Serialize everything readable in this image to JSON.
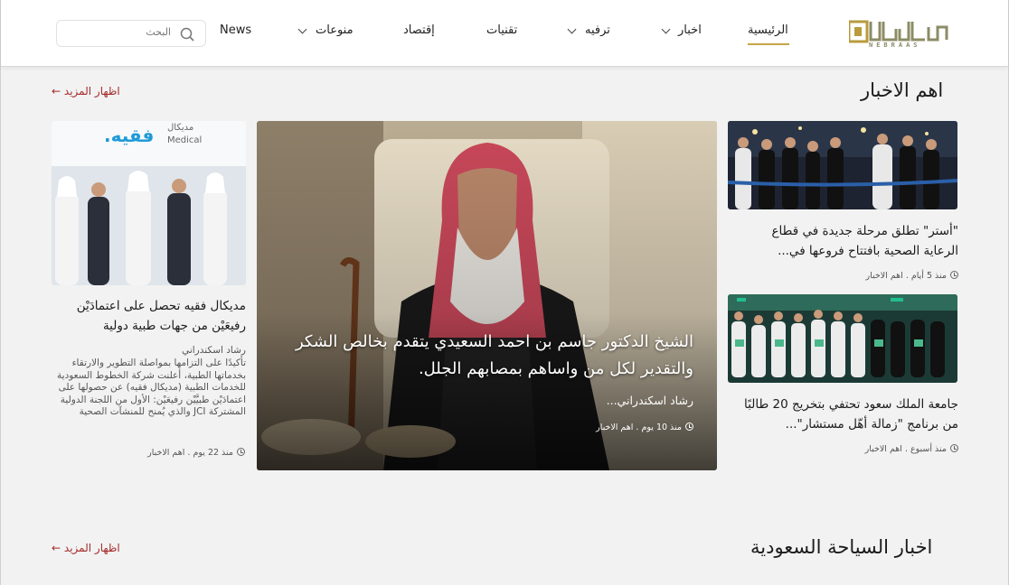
{
  "logo": {
    "wordmark": "نبراس",
    "subtitle": "NEBRAAS"
  },
  "nav": {
    "home": "الرئيسية",
    "news": "اخبار",
    "entertainment": "ترفيه",
    "tech": "تقنيات",
    "economy": "إقتصاد",
    "misc": "منوعات",
    "news_en": "News"
  },
  "search": {
    "placeholder": "البحث"
  },
  "top_news": {
    "title": "اهم الاخبار",
    "more": "اظهار المزيد"
  },
  "main_story": {
    "title": "الشيخ الدكتور جاسم بن احمد السعيدي يتقدم بخالص الشكر والتقدير لكل من واساهم بمصابهم الجلل.",
    "author": "رشاد اسكندراني...",
    "time": "منذ 10 يوم",
    "category": "اهم الاخبار"
  },
  "right_stories": [
    {
      "title": "\"أستر\" تطلق مرحلة جديدة في قطاع الرعاية الصحية بافتتاح فروعها في...",
      "time": "منذ 5 أيام",
      "category": "اهم الاخبار"
    },
    {
      "title": "جامعة الملك سعود تحتفي بتخريج 20 طالبًا من برنامج \"زمالة أهّل مستشار\"...",
      "time": "منذ أسبوع",
      "category": "اهم الاخبار"
    }
  ],
  "left_story": {
    "image_text": {
      "brand": "فقيه.",
      "label_ar": "مديكال",
      "label_en": "Medical"
    },
    "title": "مديكال فقيه تحصل على اعتمادَيْن رفيعَيْن من جهات طبية دولية",
    "author": "رشاد اسكندراني",
    "excerpt": "تأكيدًا على التزامها بمواصلة التطوير والارتقاء بخدماتها الطبية، أعلنت شركة الخطوط السعودية للخدمات الطبية (مديكال فقيه) عن حصولها على اعتمادَيْن طبيَّيْن رفيعَيْن: الأول من اللجنة الدولية المشتركة JCI والذي يُمنح للمنشآت الصحية",
    "time": "منذ 22 يوم",
    "category": "اهم الاخبار"
  },
  "tourism": {
    "title": "اخبار السياحة السعودية",
    "more": "اظهار المزيد"
  },
  "meta_sep": " . ",
  "colors": {
    "accent_gold": "#c6a545",
    "link_red": "#a52a2a",
    "background": "#f2f2f2"
  }
}
